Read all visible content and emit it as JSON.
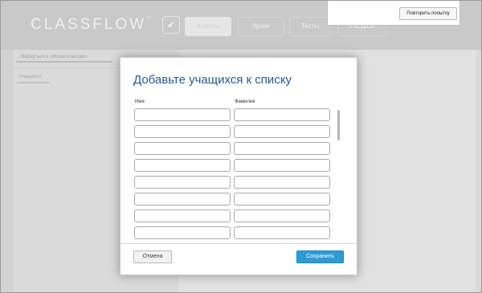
{
  "app": {
    "logo_text": "CLASSFLOW",
    "logo_mark": "™"
  },
  "nav": {
    "check_icon": "checkmark-icon",
    "tabs": [
      {
        "label": "Классы",
        "active": true
      },
      {
        "label": "Уроки",
        "active": false
      },
      {
        "label": "Тесты",
        "active": false
      },
      {
        "label": "Ресурсы",
        "active": false
      }
    ]
  },
  "notification": {
    "retry_label": "Повторить попытку"
  },
  "left_pane": {
    "back_label": "Вернуться к «Моим классам»",
    "back_icon": "chevron-left-icon",
    "section_label": "Учащиеся"
  },
  "modal": {
    "title": "Добавьте учащихся к списку",
    "first_name_header": "Имя",
    "last_name_header": "Фамилия",
    "cancel_label": "Отмена",
    "save_label": "Сохранить",
    "rows": [
      {
        "first": "",
        "last": ""
      },
      {
        "first": "",
        "last": ""
      },
      {
        "first": "",
        "last": ""
      },
      {
        "first": "",
        "last": ""
      },
      {
        "first": "",
        "last": ""
      },
      {
        "first": "",
        "last": ""
      },
      {
        "first": "",
        "last": ""
      },
      {
        "first": "",
        "last": ""
      }
    ]
  },
  "colors": {
    "accent": "#2f9bd6",
    "title": "#245a8f"
  }
}
